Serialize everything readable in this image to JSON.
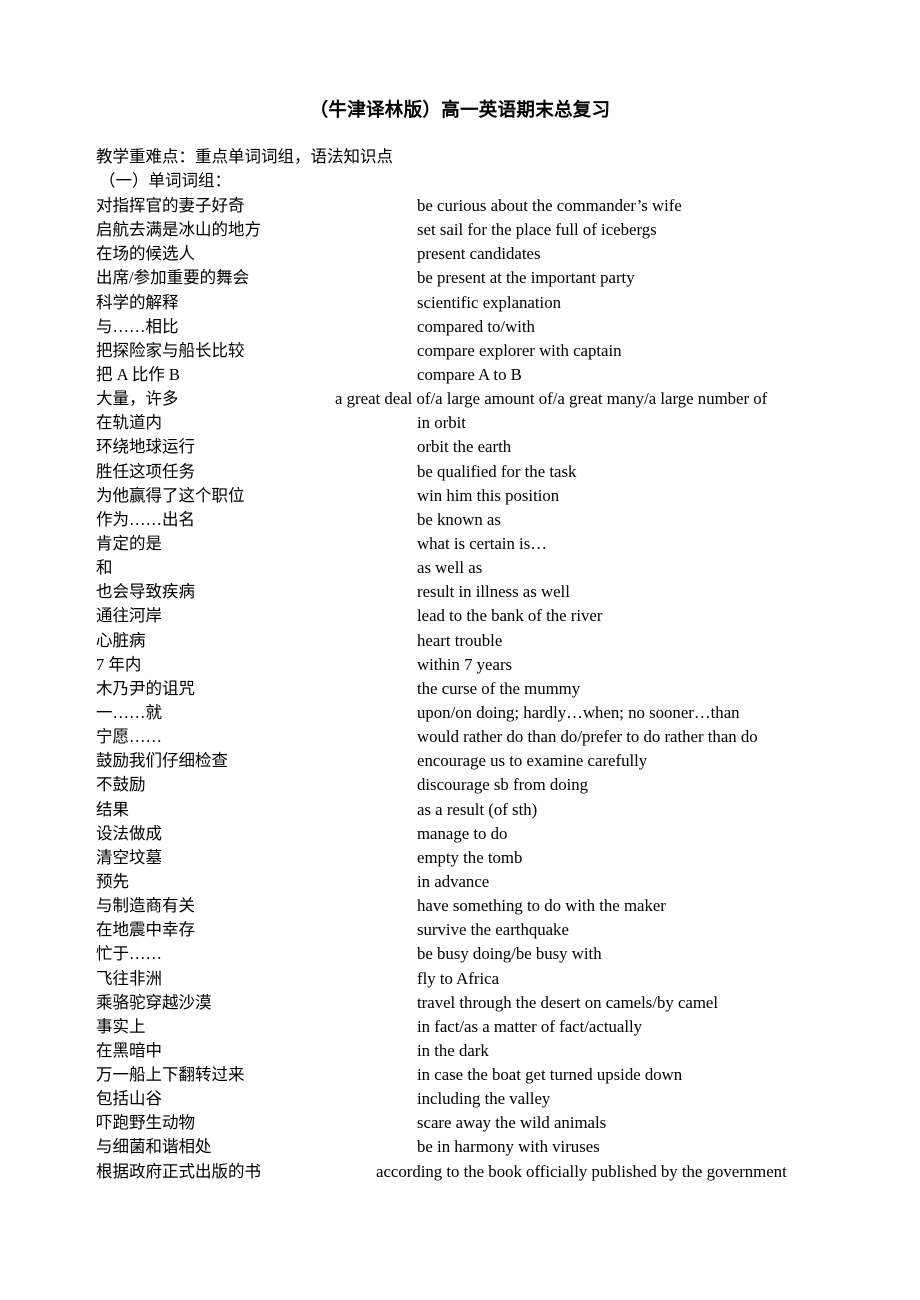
{
  "document": {
    "title": "（牛津译林版）高一英语期末总复习",
    "intro_lines": [
      "教学重难点：重点单词词组，语法知识点",
      "（一）单词词组："
    ],
    "vocab_rows": [
      {
        "cn": "对指挥官的妻子好奇",
        "en": "be curious about the commander’s wife"
      },
      {
        "cn": "启航去满是冰山的地方",
        "en": "set sail for the place full of icebergs"
      },
      {
        "cn": "在场的候选人",
        "en": "present candidates"
      },
      {
        "cn": "出席/参加重要的舞会",
        "en": "be present at the important party"
      },
      {
        "cn": "科学的解释",
        "en": "scientific explanation"
      },
      {
        "cn": "与……相比",
        "en": "compared to/with"
      },
      {
        "cn": "把探险家与船长比较",
        "en": "compare explorer with captain"
      },
      {
        "cn": "把 A 比作 B",
        "en": "compare A to B"
      },
      {
        "cn": "大量，许多",
        "en": "a great deal of/a large amount of/a great many/a large number of",
        "wide": 1
      },
      {
        "cn": "在轨道内",
        "en": "in orbit"
      },
      {
        "cn": "环绕地球运行",
        "en": "orbit the earth"
      },
      {
        "cn": "胜任这项任务",
        "en": "be qualified for the task"
      },
      {
        "cn": "为他赢得了这个职位",
        "en": "win him this position"
      },
      {
        "cn": "作为……出名",
        "en": "be known as"
      },
      {
        "cn": "肯定的是",
        "en": "what is certain is…"
      },
      {
        "cn": "和",
        "en": "as well as"
      },
      {
        "cn": "也会导致疾病",
        "en": "result in illness as well"
      },
      {
        "cn": "通往河岸",
        "en": "lead to the bank of the river"
      },
      {
        "cn": "心脏病",
        "en": "heart trouble"
      },
      {
        "cn": "7 年内",
        "en": "within 7 years"
      },
      {
        "cn": "木乃尹的诅咒",
        "en": "the curse of the mummy"
      },
      {
        "cn": "一……就",
        "en": "upon/on doing; hardly…when; no sooner…than"
      },
      {
        "cn": "宁愿……",
        "en": "would rather do than do/prefer to do rather than do"
      },
      {
        "cn": "鼓励我们仔细检查",
        "en": "encourage us to examine carefully"
      },
      {
        "cn": "不鼓励",
        "en": "discourage sb from doing"
      },
      {
        "cn": "结果",
        "en": "as a result (of sth)"
      },
      {
        "cn": "设法做成",
        "en": "manage to do"
      },
      {
        "cn": "清空坟墓",
        "en": "empty the tomb"
      },
      {
        "cn": "预先",
        "en": "in advance"
      },
      {
        "cn": "与制造商有关",
        "en": "have something to do with the maker"
      },
      {
        "cn": "在地震中幸存",
        "en": "survive the earthquake"
      },
      {
        "cn": "忙于……",
        "en": "be busy doing/be busy with"
      },
      {
        "cn": "飞往非洲",
        "en": "fly to Africa"
      },
      {
        "cn": "乘骆驼穿越沙漠",
        "en": "travel through the desert on camels/by camel"
      },
      {
        "cn": "事实上",
        "en": "in fact/as a matter of fact/actually"
      },
      {
        "cn": "在黑暗中",
        "en": "in the dark"
      },
      {
        "cn": "万一船上下翻转过来",
        "en": "in case the boat get turned upside down"
      },
      {
        "cn": "包括山谷",
        "en": "including the valley"
      },
      {
        "cn": "吓跑野生动物",
        "en": "scare away the wild animals"
      },
      {
        "cn": "与细菌和谐相处",
        "en": "be in harmony with viruses"
      },
      {
        "cn": "根据政府正式出版的书",
        "en": "according to the book officially published by the government",
        "wide": 2
      }
    ]
  }
}
